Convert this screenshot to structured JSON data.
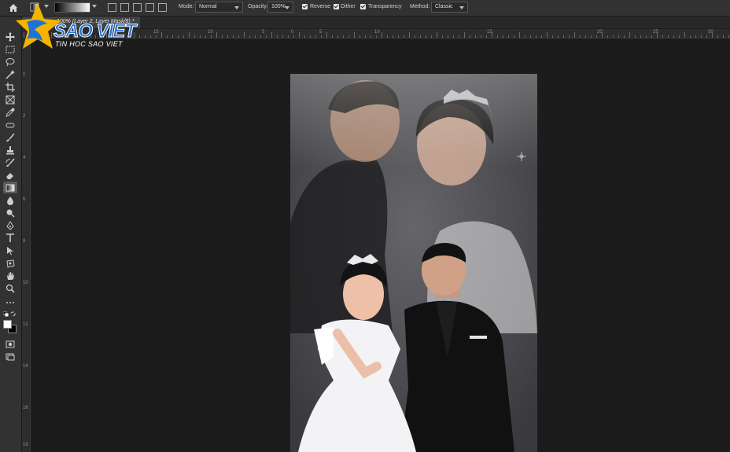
{
  "options_bar": {
    "mode_label": "Mode:",
    "mode_value": "Normal",
    "opacity_label": "Opacity:",
    "opacity_value": "100%",
    "reverse_label": "Reverse",
    "dither_label": "Dither",
    "transparency_label": "Transparency",
    "method_label": "Method:",
    "method_value": "Classic"
  },
  "document_tab": {
    "title": "100% (Layer 2, Layer Mask/8) *"
  },
  "ruler": {
    "top_numbers": [
      "15",
      "10",
      "5",
      "0",
      "5",
      "10",
      "15",
      "20",
      "25",
      "30"
    ],
    "left_numbers": [
      "0",
      "2",
      "4",
      "6",
      "8",
      "10",
      "12",
      "14",
      "16",
      "18"
    ]
  },
  "watermark": {
    "brand": "SAO VIET",
    "tagline": "TIN HOC SAO VIET"
  },
  "colors": {
    "foreground": "#ffffff",
    "background": "#000000",
    "brand_blue": "#1e73d8",
    "brand_gold": "#f4b400"
  }
}
